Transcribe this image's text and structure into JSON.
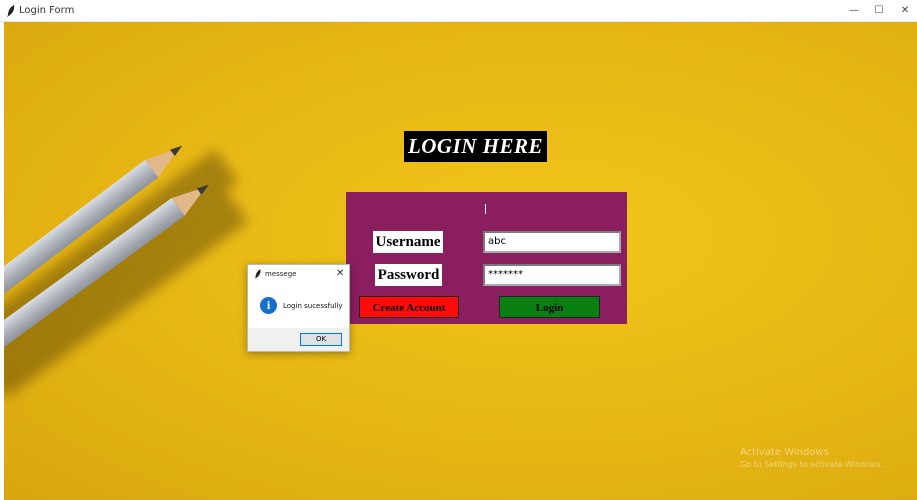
{
  "window": {
    "title": "Login Form",
    "controls": {
      "minimize": "—",
      "maximize": "☐",
      "close": "✕"
    }
  },
  "form": {
    "heading": "LOGIN HERE",
    "username_label": "Username",
    "password_label": "Password",
    "username_value": "abc",
    "password_value": "*******",
    "create_account_label": "Create Account",
    "login_label": "Login",
    "panel_color": "#8b1e5e",
    "create_button_color": "#ff0b0b",
    "login_button_color": "#0a7f12"
  },
  "dialog": {
    "title": "messege",
    "message": "Login sucessfully",
    "ok_label": "OK",
    "close_glyph": "✕",
    "icon": "info-icon",
    "icon_glyph": "i"
  },
  "watermark": {
    "line1": "Activate Windows",
    "line2": "Go to Settings to activate Windows."
  }
}
